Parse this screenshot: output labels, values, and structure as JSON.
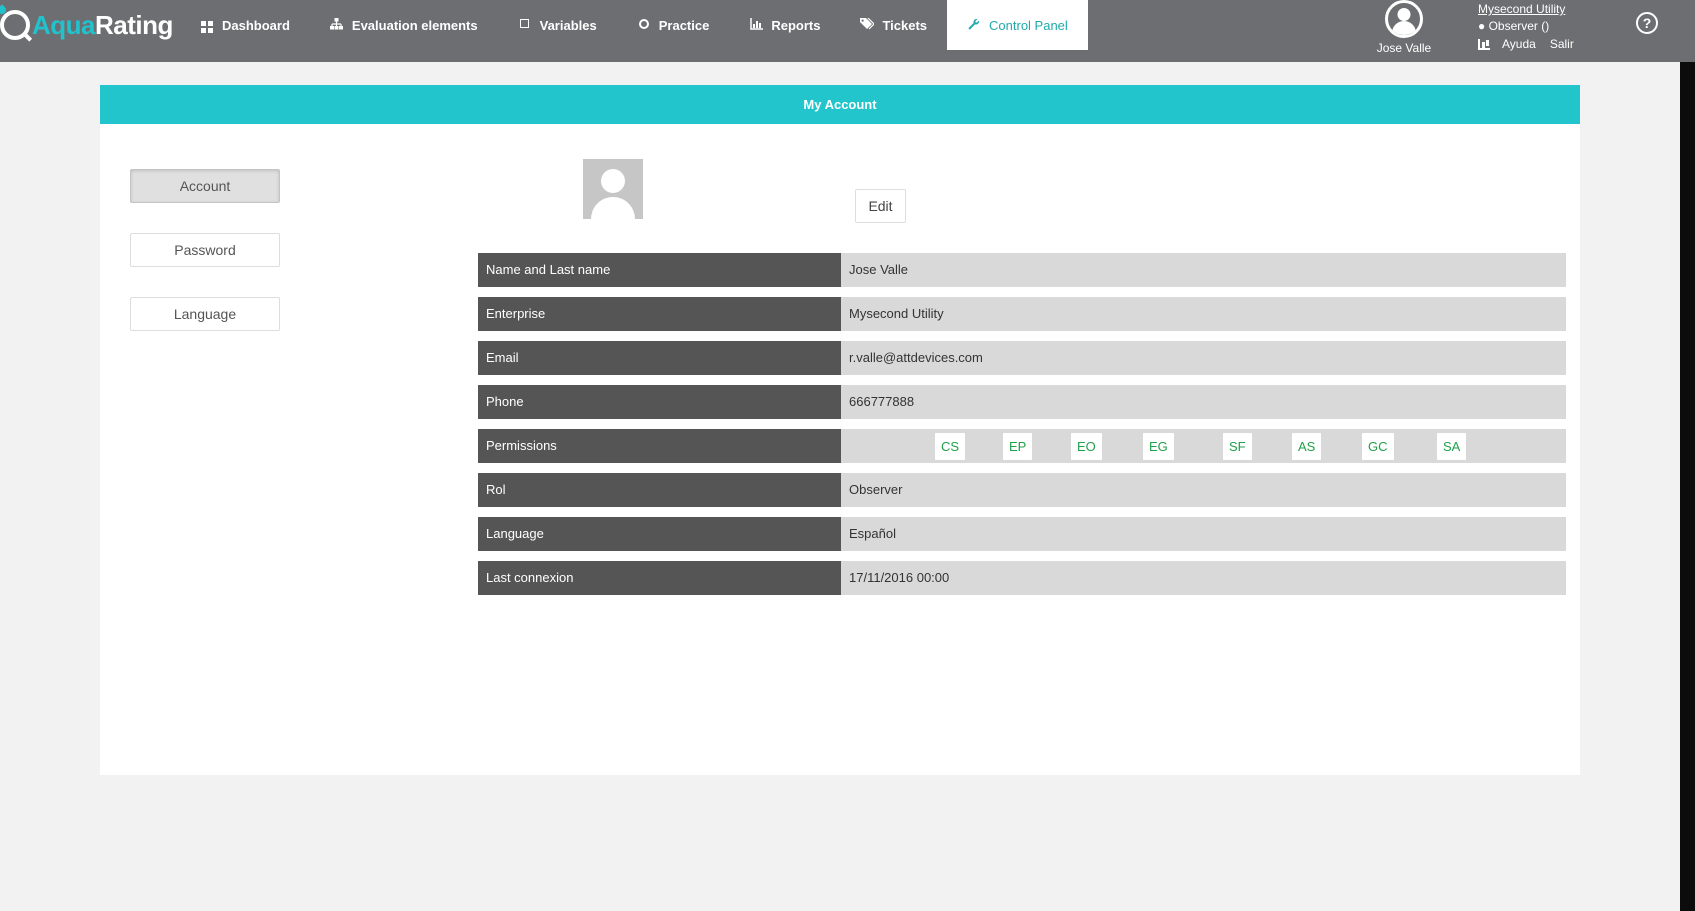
{
  "app": {
    "logo_part1": "Aqua",
    "logo_part2": "Rating"
  },
  "nav": {
    "items": [
      {
        "label": "Dashboard",
        "icon": "dashboard-grid-icon"
      },
      {
        "label": "Evaluation elements",
        "icon": "sitemap-icon"
      },
      {
        "label": "Variables",
        "icon": "square-icon"
      },
      {
        "label": "Practice",
        "icon": "circle-icon"
      },
      {
        "label": "Reports",
        "icon": "bar-chart-icon"
      },
      {
        "label": "Tickets",
        "icon": "tags-icon"
      },
      {
        "label": "Control Panel",
        "icon": "wrench-icon",
        "active": true
      }
    ]
  },
  "user": {
    "name": "Jose Valle",
    "enterprise": "Mysecond Utility",
    "role_line": "● Observer ()",
    "help_label": "Ayuda",
    "logout_label": "Salir",
    "help_symbol": "?"
  },
  "card": {
    "title": "My Account",
    "side_buttons": [
      "Account",
      "Password",
      "Language"
    ],
    "edit_label": "Edit"
  },
  "info": {
    "rows": [
      {
        "label": "Name and Last name",
        "value": "Jose Valle"
      },
      {
        "label": "Enterprise",
        "value": "Mysecond Utility"
      },
      {
        "label": "Email",
        "value": "r.valle@attdevices.com"
      },
      {
        "label": "Phone",
        "value": "666777888"
      },
      {
        "label": "Permissions",
        "value": ""
      },
      {
        "label": "Rol",
        "value": "Observer"
      },
      {
        "label": "Language",
        "value": "Español"
      },
      {
        "label": "Last connexion",
        "value": "17/11/2016 00:00"
      }
    ],
    "permissions": [
      "CS",
      "EP",
      "EO",
      "EG",
      "SF",
      "AS",
      "GC",
      "SA"
    ]
  },
  "colors": {
    "navbar": "#6d6e71",
    "accent": "#22c5cb",
    "label_bg": "#555555",
    "value_bg": "#d9d9d9",
    "permission_text": "#21a04a"
  }
}
